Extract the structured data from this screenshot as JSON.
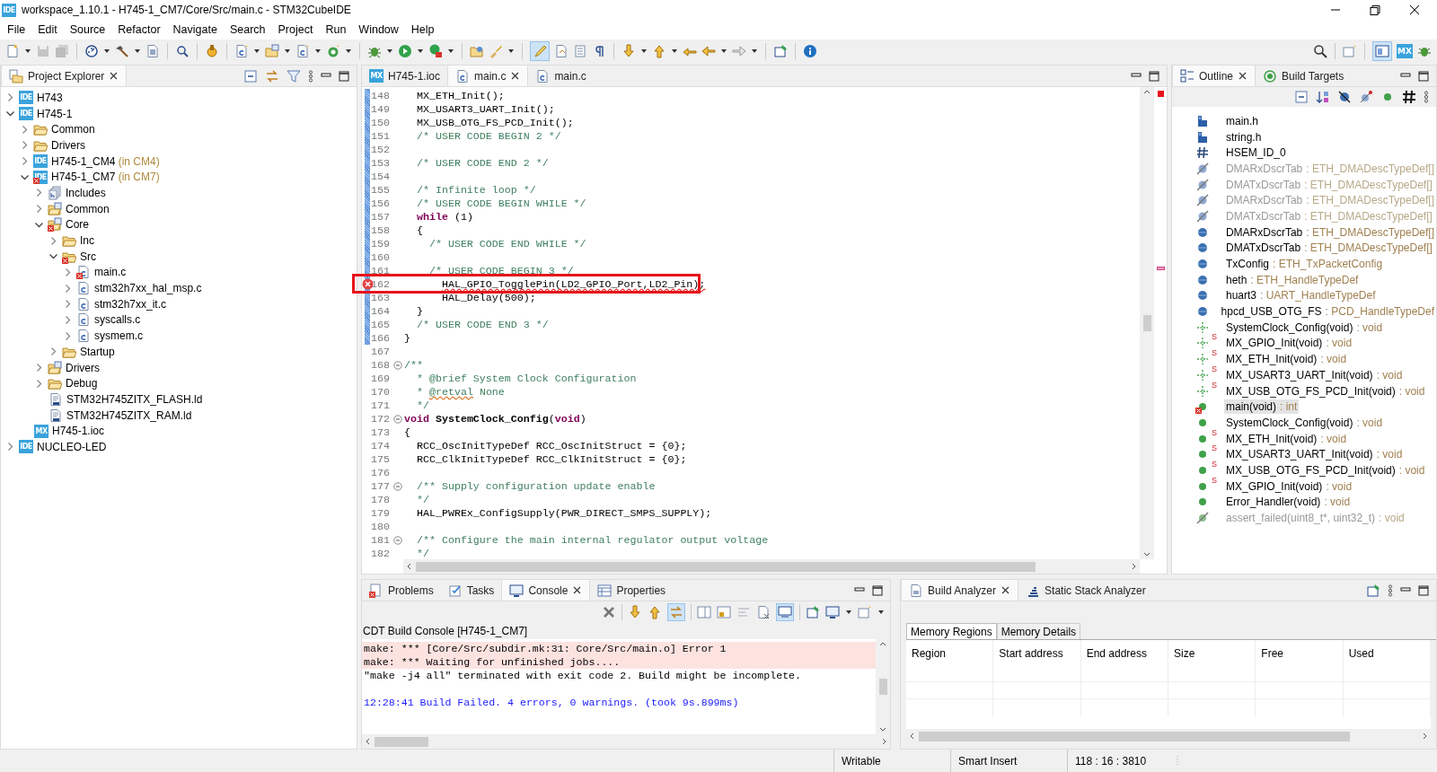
{
  "window": {
    "badge": "IDE",
    "title": "workspace_1.10.1 - H745-1_CM7/Core/Src/main.c - STM32CubeIDE"
  },
  "menu": [
    "File",
    "Edit",
    "Source",
    "Refactor",
    "Navigate",
    "Search",
    "Project",
    "Run",
    "Window",
    "Help"
  ],
  "toolbar": {
    "perspective_badge": "MX"
  },
  "explorer": {
    "title": "Project Explorer",
    "items": [
      {
        "label": "H743",
        "kind": "project",
        "badge": "IDE",
        "error": false,
        "expanded": false
      },
      {
        "label": "H745-1",
        "kind": "project",
        "badge": "IDE",
        "error": false,
        "expanded": true,
        "children": [
          {
            "label": "Common",
            "kind": "folder",
            "error": false,
            "expanded": false
          },
          {
            "label": "Drivers",
            "kind": "folder",
            "error": false,
            "expanded": false
          },
          {
            "label": "H745-1_CM4",
            "suffix": "(in CM4)",
            "kind": "project",
            "badge": "IDE",
            "error": false,
            "expanded": false
          },
          {
            "label": "H745-1_CM7",
            "suffix": "(in CM7)",
            "kind": "project",
            "badge": "IDE",
            "error": true,
            "expanded": true,
            "children": [
              {
                "label": "Includes",
                "kind": "includes",
                "error": false,
                "expanded": false
              },
              {
                "label": "Common",
                "kind": "source-folder",
                "error": false,
                "expanded": false
              },
              {
                "label": "Core",
                "kind": "source-folder",
                "error": true,
                "expanded": true,
                "children": [
                  {
                    "label": "Inc",
                    "kind": "folder",
                    "error": false,
                    "expanded": false
                  },
                  {
                    "label": "Src",
                    "kind": "folder",
                    "error": true,
                    "expanded": true,
                    "children": [
                      {
                        "label": "main.c",
                        "kind": "c-file",
                        "error": true,
                        "expanded": false
                      },
                      {
                        "label": "stm32h7xx_hal_msp.c",
                        "kind": "c-file",
                        "error": false,
                        "expanded": false
                      },
                      {
                        "label": "stm32h7xx_it.c",
                        "kind": "c-file",
                        "error": false,
                        "expanded": false
                      },
                      {
                        "label": "syscalls.c",
                        "kind": "c-file",
                        "error": false,
                        "expanded": false
                      },
                      {
                        "label": "sysmem.c",
                        "kind": "c-file",
                        "error": false,
                        "expanded": false
                      }
                    ]
                  },
                  {
                    "label": "Startup",
                    "kind": "folder",
                    "error": false,
                    "expanded": false
                  }
                ]
              },
              {
                "label": "Drivers",
                "kind": "source-folder",
                "error": false,
                "expanded": false
              },
              {
                "label": "Debug",
                "kind": "folder",
                "error": false,
                "expanded": false
              },
              {
                "label": "STM32H745ZITX_FLASH.ld",
                "kind": "ld-file",
                "error": false
              },
              {
                "label": "STM32H745ZITX_RAM.ld",
                "kind": "ld-file",
                "error": false
              }
            ]
          },
          {
            "label": "H745-1.ioc",
            "kind": "mx-file",
            "badge": "MX",
            "error": false
          }
        ]
      },
      {
        "label": "NUCLEO-LED",
        "kind": "project",
        "badge": "IDE",
        "error": false,
        "expanded": false
      }
    ]
  },
  "editor": {
    "tabs": [
      {
        "label": "H745-1.ioc",
        "kind": "mx-file",
        "badge": "MX",
        "selected": false
      },
      {
        "label": "main.c",
        "kind": "c-file",
        "selected": true
      },
      {
        "label": "main.c",
        "kind": "c-file",
        "selected": false
      }
    ],
    "lines": [
      {
        "number": "148",
        "changed": true,
        "fold": false,
        "error": false,
        "highlighted": false,
        "segments": [
          {
            "kind": "plain",
            "text": "  MX_ETH_Init();"
          }
        ]
      },
      {
        "number": "149",
        "changed": true,
        "fold": false,
        "error": false,
        "highlighted": false,
        "segments": [
          {
            "kind": "plain",
            "text": "  MX_USART3_UART_Init();"
          }
        ]
      },
      {
        "number": "150",
        "changed": true,
        "fold": false,
        "error": false,
        "highlighted": false,
        "segments": [
          {
            "kind": "plain",
            "text": "  MX_USB_OTG_FS_PCD_Init();"
          }
        ]
      },
      {
        "number": "151",
        "changed": true,
        "fold": false,
        "error": false,
        "highlighted": false,
        "segments": [
          {
            "kind": "comment",
            "text": "  /* USER CODE BEGIN 2 */"
          }
        ]
      },
      {
        "number": "152",
        "changed": true,
        "fold": false,
        "error": false,
        "highlighted": false
      },
      {
        "number": "153",
        "changed": true,
        "fold": false,
        "error": false,
        "highlighted": false,
        "segments": [
          {
            "kind": "comment",
            "text": "  /* USER CODE END 2 */"
          }
        ]
      },
      {
        "number": "154",
        "changed": true,
        "fold": false,
        "error": false,
        "highlighted": false
      },
      {
        "number": "155",
        "changed": true,
        "fold": false,
        "error": false,
        "highlighted": false,
        "segments": [
          {
            "kind": "comment",
            "text": "  /* Infinite loop */"
          }
        ]
      },
      {
        "number": "156",
        "changed": true,
        "fold": false,
        "error": false,
        "highlighted": false,
        "segments": [
          {
            "kind": "comment",
            "text": "  /* USER CODE BEGIN WHILE */"
          }
        ]
      },
      {
        "number": "157",
        "changed": true,
        "fold": false,
        "error": false,
        "highlighted": false,
        "segments": [
          {
            "kind": "keyword",
            "text": "  while"
          },
          {
            "kind": "plain",
            "text": " (1)"
          }
        ]
      },
      {
        "number": "158",
        "changed": true,
        "fold": false,
        "error": false,
        "highlighted": false,
        "segments": [
          {
            "kind": "plain",
            "text": "  {"
          }
        ]
      },
      {
        "number": "159",
        "changed": true,
        "fold": false,
        "error": false,
        "highlighted": false,
        "segments": [
          {
            "kind": "comment",
            "text": "    /* USER CODE END WHILE */"
          }
        ]
      },
      {
        "number": "160",
        "changed": true,
        "fold": false,
        "error": false,
        "highlighted": false
      },
      {
        "number": "161",
        "changed": true,
        "fold": false,
        "error": false,
        "highlighted": false,
        "segments": [
          {
            "kind": "comment",
            "text": "    /* USER CODE BEGIN 3 */"
          }
        ]
      },
      {
        "number": "162",
        "changed": true,
        "fold": false,
        "error": true,
        "highlighted": true,
        "segments": [
          {
            "kind": "error",
            "text": "      HAL_GPIO_TogglePin(LD2_GPIO_Port,LD2_Pin);"
          }
        ]
      },
      {
        "number": "163",
        "changed": true,
        "fold": false,
        "error": false,
        "highlighted": false,
        "segments": [
          {
            "kind": "plain",
            "text": "      HAL_Delay(500);"
          }
        ]
      },
      {
        "number": "164",
        "changed": true,
        "fold": false,
        "error": false,
        "highlighted": false,
        "segments": [
          {
            "kind": "plain",
            "text": "  }"
          }
        ]
      },
      {
        "number": "165",
        "changed": true,
        "fold": false,
        "error": false,
        "highlighted": false,
        "segments": [
          {
            "kind": "comment",
            "text": "  /* USER CODE END 3 */"
          }
        ]
      },
      {
        "number": "166",
        "changed": true,
        "fold": false,
        "error": false,
        "highlighted": false,
        "segments": [
          {
            "kind": "plain",
            "text": "}"
          }
        ]
      },
      {
        "number": "167",
        "changed": false,
        "fold": false,
        "error": false,
        "highlighted": false
      },
      {
        "number": "168",
        "changed": false,
        "fold": true,
        "error": false,
        "highlighted": false,
        "segments": [
          {
            "kind": "comment",
            "text": "/**"
          }
        ]
      },
      {
        "number": "169",
        "changed": false,
        "fold": false,
        "error": false,
        "highlighted": false,
        "segments": [
          {
            "kind": "comment",
            "text": "  * @brief System Clock Configuration"
          }
        ]
      },
      {
        "number": "170",
        "changed": false,
        "fold": false,
        "error": false,
        "highlighted": false,
        "segments": [
          {
            "kind": "comment",
            "text": "  *"
          },
          {
            "kind": "misspelled",
            "text": " @retval"
          },
          {
            "kind": "comment",
            "text": " None"
          }
        ]
      },
      {
        "number": "171",
        "changed": false,
        "fold": false,
        "error": false,
        "highlighted": false,
        "segments": [
          {
            "kind": "comment",
            "text": "  */"
          }
        ]
      },
      {
        "number": "172",
        "changed": false,
        "fold": true,
        "error": false,
        "highlighted": false,
        "segments": [
          {
            "kind": "keyword",
            "text": "void"
          },
          {
            "kind": "function",
            "text": " SystemClock_Config"
          },
          {
            "kind": "plain",
            "text": "("
          },
          {
            "kind": "keyword",
            "text": "void"
          },
          {
            "kind": "plain",
            "text": ")"
          }
        ]
      },
      {
        "number": "173",
        "changed": false,
        "fold": false,
        "error": false,
        "highlighted": false,
        "segments": [
          {
            "kind": "plain",
            "text": "{"
          }
        ]
      },
      {
        "number": "174",
        "changed": false,
        "fold": false,
        "error": false,
        "highlighted": false,
        "segments": [
          {
            "kind": "plain",
            "text": "  RCC_OscInitTypeDef RCC_OscInitStruct = {0};"
          }
        ]
      },
      {
        "number": "175",
        "changed": false,
        "fold": false,
        "error": false,
        "highlighted": false,
        "segments": [
          {
            "kind": "plain",
            "text": "  RCC_ClkInitTypeDef RCC_ClkInitStruct = {0};"
          }
        ]
      },
      {
        "number": "176",
        "changed": false,
        "fold": false,
        "error": false,
        "highlighted": false
      },
      {
        "number": "177",
        "changed": false,
        "fold": true,
        "error": false,
        "highlighted": false,
        "segments": [
          {
            "kind": "comment",
            "text": "  /** Supply configuration update enable"
          }
        ]
      },
      {
        "number": "178",
        "changed": false,
        "fold": false,
        "error": false,
        "highlighted": false,
        "segments": [
          {
            "kind": "comment",
            "text": "  */"
          }
        ]
      },
      {
        "number": "179",
        "changed": false,
        "fold": false,
        "error": false,
        "highlighted": false,
        "segments": [
          {
            "kind": "plain",
            "text": "  HAL_PWREx_ConfigSupply(PWR_DIRECT_SMPS_SUPPLY);"
          }
        ]
      },
      {
        "number": "180",
        "changed": false,
        "fold": false,
        "error": false,
        "highlighted": false
      },
      {
        "number": "181",
        "changed": false,
        "fold": true,
        "error": false,
        "highlighted": false,
        "segments": [
          {
            "kind": "comment",
            "text": "  /** Configure the main internal regulator output voltage"
          }
        ]
      },
      {
        "number": "182",
        "changed": false,
        "fold": false,
        "error": false,
        "highlighted": false,
        "segments": [
          {
            "kind": "comment",
            "text": "  */"
          }
        ]
      }
    ]
  },
  "outline": {
    "tabs": [
      {
        "label": "Outline",
        "kind": "outline",
        "selected": true
      },
      {
        "label": "Build Targets",
        "kind": "targets",
        "selected": false
      }
    ],
    "items": [
      {
        "name": "main.h",
        "kind": "include",
        "error": false,
        "inactive": false,
        "selected": false
      },
      {
        "name": "string.h",
        "kind": "include",
        "error": false,
        "inactive": false,
        "selected": false
      },
      {
        "name": "HSEM_ID_0",
        "kind": "macro",
        "error": false,
        "inactive": false,
        "selected": false
      },
      {
        "name": "DMARxDscrTab",
        "type": ": ETH_DMADescTypeDef[]",
        "kind": "variable-declaration",
        "error": false,
        "inactive": true,
        "selected": false
      },
      {
        "name": "DMATxDscrTab",
        "type": ": ETH_DMADescTypeDef[]",
        "kind": "variable-declaration",
        "error": false,
        "inactive": true,
        "selected": false
      },
      {
        "name": "DMARxDscrTab",
        "type": ": ETH_DMADescTypeDef[]",
        "kind": "variable-declaration",
        "error": false,
        "inactive": true,
        "selected": false
      },
      {
        "name": "DMATxDscrTab",
        "type": ": ETH_DMADescTypeDef[]",
        "kind": "variable-declaration",
        "error": false,
        "inactive": true,
        "selected": false
      },
      {
        "name": "DMARxDscrTab",
        "type": ": ETH_DMADescTypeDef[]",
        "kind": "variable",
        "error": false,
        "inactive": false,
        "selected": false
      },
      {
        "name": "DMATxDscrTab",
        "type": ": ETH_DMADescTypeDef[]",
        "kind": "variable",
        "error": false,
        "inactive": false,
        "selected": false
      },
      {
        "name": "TxConfig",
        "type": ": ETH_TxPacketConfig",
        "kind": "variable",
        "error": false,
        "inactive": false,
        "selected": false
      },
      {
        "name": "heth",
        "type": ": ETH_HandleTypeDef",
        "kind": "variable",
        "error": false,
        "inactive": false,
        "selected": false
      },
      {
        "name": "huart3",
        "type": ": UART_HandleTypeDef",
        "kind": "variable",
        "error": false,
        "inactive": false,
        "selected": false
      },
      {
        "name": "hpcd_USB_OTG_FS",
        "type": ": PCD_HandleTypeDef",
        "kind": "variable",
        "error": false,
        "inactive": false,
        "selected": false
      },
      {
        "name": "SystemClock_Config(void)",
        "type": ": void",
        "kind": "function-declaration",
        "error": false,
        "inactive": false,
        "selected": false
      },
      {
        "name": "MX_GPIO_Init(void)",
        "type": ": void",
        "kind": "function-declaration",
        "flag": "S",
        "error": false,
        "inactive": false,
        "selected": false
      },
      {
        "name": "MX_ETH_Init(void)",
        "type": ": void",
        "kind": "function-declaration",
        "flag": "S",
        "error": false,
        "inactive": false,
        "selected": false
      },
      {
        "name": "MX_USART3_UART_Init(void)",
        "type": ": void",
        "kind": "function-declaration",
        "flag": "S",
        "error": false,
        "inactive": false,
        "selected": false
      },
      {
        "name": "MX_USB_OTG_FS_PCD_Init(void)",
        "type": ": void",
        "kind": "function-declaration",
        "flag": "S",
        "error": false,
        "inactive": false,
        "selected": false
      },
      {
        "name": "main(void)",
        "type": ": int",
        "kind": "function",
        "error": true,
        "inactive": false,
        "selected": true
      },
      {
        "name": "SystemClock_Config(void)",
        "type": ": void",
        "kind": "function",
        "error": false,
        "inactive": false,
        "selected": false
      },
      {
        "name": "MX_ETH_Init(void)",
        "type": ": void",
        "kind": "function",
        "flag": "S",
        "error": false,
        "inactive": false,
        "selected": false
      },
      {
        "name": "MX_USART3_UART_Init(void)",
        "type": ": void",
        "kind": "function",
        "flag": "S",
        "error": false,
        "inactive": false,
        "selected": false
      },
      {
        "name": "MX_USB_OTG_FS_PCD_Init(void)",
        "type": ": void",
        "kind": "function",
        "flag": "S",
        "error": false,
        "inactive": false,
        "selected": false
      },
      {
        "name": "MX_GPIO_Init(void)",
        "type": ": void",
        "kind": "function",
        "flag": "S",
        "error": false,
        "inactive": false,
        "selected": false
      },
      {
        "name": "Error_Handler(void)",
        "type": ": void",
        "kind": "function",
        "error": false,
        "inactive": false,
        "selected": false
      },
      {
        "name": "assert_failed(uint8_t*, uint32_t)",
        "type": ": void",
        "kind": "function-inactive",
        "error": false,
        "inactive": true,
        "selected": false
      }
    ]
  },
  "console": {
    "tabs": [
      {
        "label": "Problems",
        "kind": "problems",
        "selected": false
      },
      {
        "label": "Tasks",
        "kind": "tasks",
        "selected": false
      },
      {
        "label": "Console",
        "kind": "console",
        "selected": true
      },
      {
        "label": "Properties",
        "kind": "properties",
        "selected": false
      }
    ],
    "header": "CDT Build Console [H745-1_CM7]",
    "lines": [
      {
        "kind": "error",
        "text": "make: *** [Core/Src/subdir.mk:31: Core/Src/main.o] Error 1"
      },
      {
        "kind": "error",
        "text": "make: *** Waiting for unfinished jobs...."
      },
      {
        "kind": "plain",
        "text": "\"make -j4 all\" terminated with exit code 2. Build might be incomplete."
      },
      {
        "kind": "info",
        "text": "12:28:41 Build Failed. 4 errors, 0 warnings. (took 9s.899ms)"
      }
    ]
  },
  "analyzer": {
    "tabs": [
      {
        "label": "Build Analyzer",
        "kind": "build",
        "selected": true
      },
      {
        "label": "Static Stack Analyzer",
        "kind": "stack",
        "selected": false
      }
    ],
    "subtabs": [
      {
        "label": "Memory Regions",
        "selected": true
      },
      {
        "label": "Memory Details",
        "selected": false
      }
    ],
    "columns": [
      "Region",
      "Start address",
      "End address",
      "Size",
      "Free",
      "Used"
    ]
  },
  "status_bar": [
    "Writable",
    "Smart Insert",
    "118 : 16 : 3810"
  ]
}
